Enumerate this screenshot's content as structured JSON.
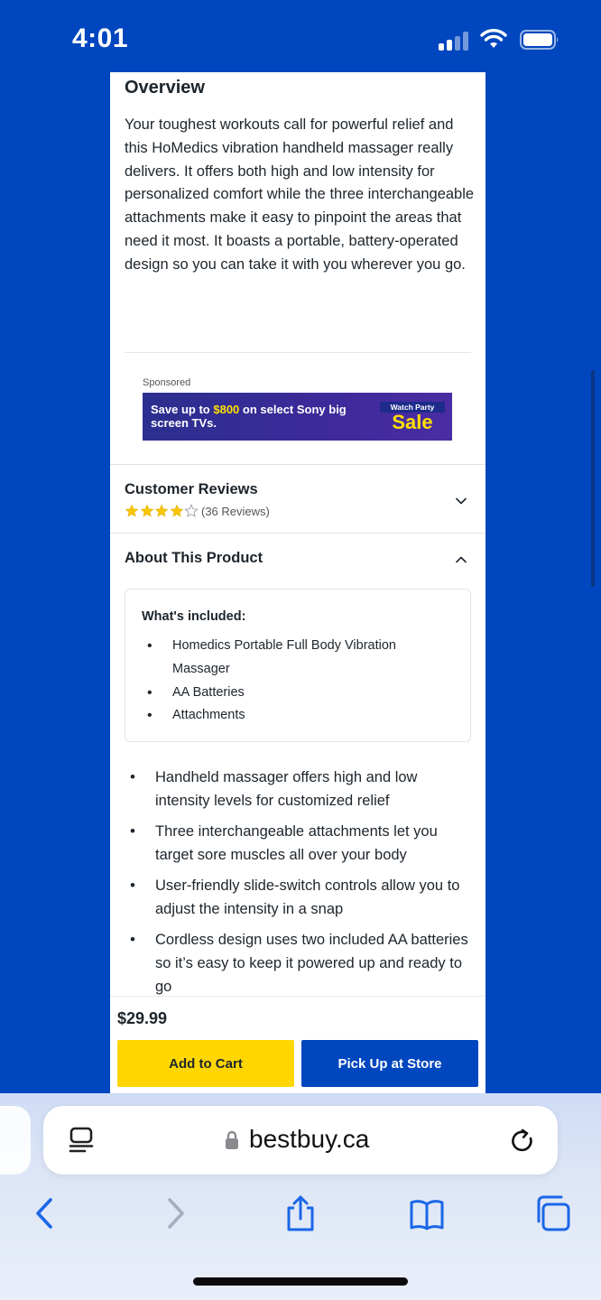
{
  "status_bar": {
    "time": "4:01",
    "signal_icon": "cellular-signal-icon",
    "wifi_icon": "wifi-icon",
    "battery_icon": "battery-icon"
  },
  "overview": {
    "title": "Overview",
    "text": "Your toughest workouts call for powerful relief and this HoMedics vibration handheld massager really delivers. It offers both high and low intensity for personalized comfort while the three interchangeable attachments make it easy to pinpoint the areas that need it most. It boasts a portable, battery-operated design so you can take it with you wherever you go."
  },
  "ad": {
    "sponsored_label": "Sponsored",
    "text_prefix": "Save up to ",
    "text_highlight": "$800",
    "text_suffix": " on select Sony big screen TVs.",
    "badge_top": "Watch Party",
    "badge_main": "Sale"
  },
  "reviews": {
    "title": "Customer Reviews",
    "rating": 4,
    "max_rating": 5,
    "count_label": "(36 Reviews)"
  },
  "about": {
    "title": "About This Product",
    "included_title": "What's included:",
    "included_items": [
      "Homedics Portable Full Body Vibration Massager",
      "AA Batteries",
      "Attachments"
    ],
    "features": [
      "Handheld massager offers high and low intensity levels for customized relief",
      "Three interchangeable attachments let you target sore muscles all over your body",
      "User-friendly slide-switch controls allow you to adjust the intensity in a snap",
      "Cordless design uses two included AA batteries so it’s easy to keep it powered up and ready to go"
    ]
  },
  "purchase": {
    "price": "$29.99",
    "add_to_cart_label": "Add to Cart",
    "pickup_label": "Pick Up at Store",
    "cart_color": "#ffd600",
    "pickup_color": "#0046be"
  },
  "browser": {
    "url": "bestbuy.ca",
    "toolbar_icons": [
      "back-icon",
      "forward-icon",
      "share-icon",
      "bookmarks-icon",
      "tabs-icon"
    ]
  },
  "colors": {
    "brand_blue": "#0046be",
    "brand_yellow": "#ffd600",
    "star_yellow": "#f7c600"
  }
}
